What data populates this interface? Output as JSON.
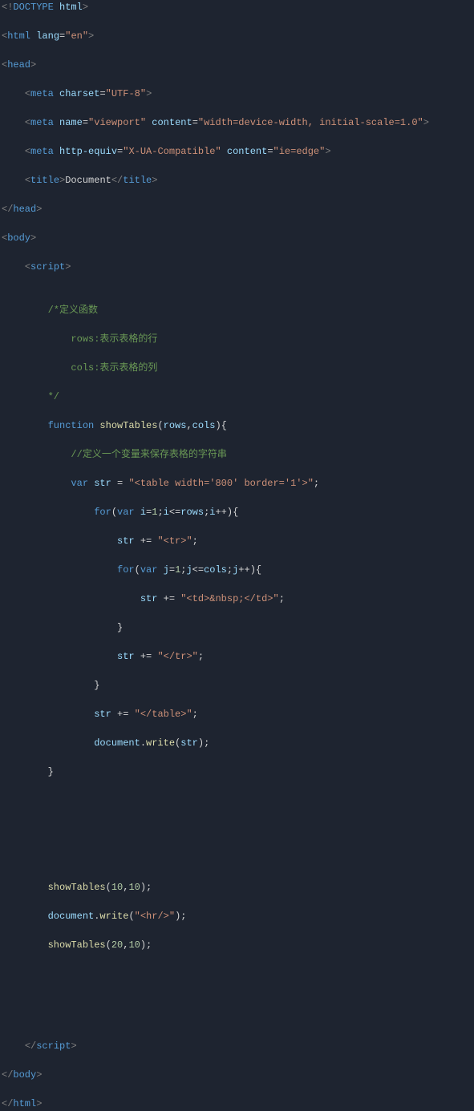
{
  "lines": {
    "l1": {
      "open": "<",
      "bang": "!",
      "doctype": "DOCTYPE",
      "sp": " ",
      "html": "html",
      "close": ">"
    },
    "l2": {
      "open": "<",
      "tag": "html",
      "sp": " ",
      "attr": "lang",
      "eq": "=",
      "q1": "\"",
      "val": "en",
      "q2": "\"",
      "close": ">"
    },
    "l3": {
      "open": "<",
      "tag": "head",
      "close": ">"
    },
    "l4_ind": "    ",
    "l4": {
      "open": "<",
      "tag": "meta",
      "sp": " ",
      "attr": "charset",
      "eq": "=",
      "q1": "\"",
      "val": "UTF-8",
      "q2": "\"",
      "close": ">"
    },
    "l5": {
      "ind": "    ",
      "open": "<",
      "tag": "meta",
      "sp": " ",
      "a1": "name",
      "eq": "=",
      "q1": "\"",
      "v1": "viewport",
      "q2": "\"",
      "sp2": " ",
      "a2": "content",
      "eq2": "=",
      "q3": "\"",
      "v2": "width=device-width, initial-scale=1.0",
      "q4": "\"",
      "close": ">"
    },
    "l6": {
      "ind": "    ",
      "open": "<",
      "tag": "meta",
      "sp": " ",
      "a1": "http-equiv",
      "eq": "=",
      "q1": "\"",
      "v1": "X-UA-Compatible",
      "q2": "\"",
      "sp2": " ",
      "a2": "content",
      "eq2": "=",
      "q3": "\"",
      "v2": "ie=edge",
      "q4": "\"",
      "close": ">"
    },
    "l7": {
      "ind": "    ",
      "open": "<",
      "tag": "title",
      "close": ">",
      "text": "Document",
      "open2": "</",
      "tag2": "title",
      "close2": ">"
    },
    "l8": {
      "open": "</",
      "tag": "head",
      "close": ">"
    },
    "l9": {
      "open": "<",
      "tag": "body",
      "close": ">"
    },
    "l10": {
      "ind": "    ",
      "open": "<",
      "tag": "script",
      "close": ">"
    },
    "c1": {
      "ind": "        ",
      "text": "/*定义函数"
    },
    "c2": {
      "ind": "            ",
      "text": "rows:表示表格的行"
    },
    "c3": {
      "ind": "            ",
      "text": "cols:表示表格的列"
    },
    "c4": {
      "ind": "        ",
      "text": "*/"
    },
    "fn": {
      "ind": "        ",
      "kw": "function",
      "sp": " ",
      "name": "showTables",
      "p1": "(",
      "arg1": "rows",
      "comma": ",",
      "arg2": "cols",
      "p2": ")",
      "brace": "{"
    },
    "c5": {
      "ind": "            ",
      "text": "//定义一个变量来保存表格的字符串"
    },
    "vs": {
      "ind": "            ",
      "kw": "var",
      "sp": " ",
      "name": "str",
      "sp2": " ",
      "eq": "=",
      "sp3": " ",
      "q1": "\"",
      "val": "<table width='800' border='1'>",
      "q2": "\"",
      "semi": ";"
    },
    "for1": {
      "ind": "                ",
      "kw": "for",
      "p1": "(",
      "kw2": "var",
      "sp": " ",
      "v": "i",
      "eq": "=",
      "n1": "1",
      "semi": ";",
      "v2": "i",
      "op": "<=",
      "r": "rows",
      "semi2": ";",
      "v3": "i",
      "inc": "++",
      "p2": ")",
      "brace": "{"
    },
    "s1": {
      "ind": "                    ",
      "v": "str",
      "sp": " ",
      "op": "+=",
      "sp2": " ",
      "q1": "\"",
      "val": "<tr>",
      "q2": "\"",
      "semi": ";"
    },
    "for2": {
      "ind": "                    ",
      "kw": "for",
      "p1": "(",
      "kw2": "var",
      "sp": " ",
      "v": "j",
      "eq": "=",
      "n1": "1",
      "semi": ";",
      "v2": "j",
      "op": "<=",
      "r": "cols",
      "semi2": ";",
      "v3": "j",
      "inc": "++",
      "p2": ")",
      "brace": "{"
    },
    "s2": {
      "ind": "                        ",
      "v": "str",
      "sp": " ",
      "op": "+=",
      "sp2": " ",
      "q1": "\"",
      "val": "<td>&nbsp;</td>",
      "q2": "\"",
      "semi": ";"
    },
    "cb1": {
      "ind": "                    ",
      "brace": "}"
    },
    "s3": {
      "ind": "                    ",
      "v": "str",
      "sp": " ",
      "op": "+=",
      "sp2": " ",
      "q1": "\"",
      "val": "</tr>",
      "q2": "\"",
      "semi": ";"
    },
    "cb2": {
      "ind": "                ",
      "brace": "}"
    },
    "s4": {
      "ind": "                ",
      "v": "str",
      "sp": " ",
      "op": "+=",
      "sp2": " ",
      "q1": "\"",
      "val": "</table>",
      "q2": "\"",
      "semi": ";"
    },
    "dw": {
      "ind": "                ",
      "o": "document",
      "dot": ".",
      "m": "write",
      "p1": "(",
      "arg": "str",
      "p2": ")",
      "semi": ";"
    },
    "cb3": {
      "ind": "        ",
      "brace": "}"
    },
    "call1": {
      "ind": "        ",
      "fn": "showTables",
      "p1": "(",
      "n1": "10",
      "comma": ",",
      "n2": "10",
      "p2": ")",
      "semi": ";"
    },
    "dw2": {
      "ind": "        ",
      "o": "document",
      "dot": ".",
      "m": "write",
      "p1": "(",
      "q1": "\"",
      "val": "<hr/>",
      "q2": "\"",
      "p2": ")",
      "semi": ";"
    },
    "call2": {
      "ind": "        ",
      "fn": "showTables",
      "p1": "(",
      "n1": "20",
      "comma": ",",
      "n2": "10",
      "p2": ")",
      "semi": ";"
    },
    "cscript": {
      "ind": "    ",
      "open": "</",
      "tag": "script",
      "close": ">"
    },
    "cbody": {
      "open": "</",
      "tag": "body",
      "close": ">"
    },
    "chtml": {
      "open": "</",
      "tag": "html",
      "close": ">"
    }
  }
}
